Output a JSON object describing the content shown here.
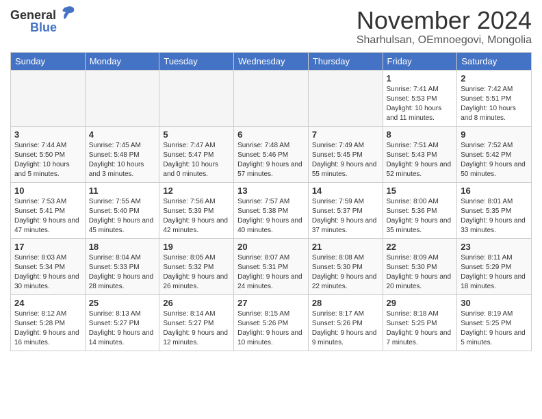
{
  "header": {
    "logo": {
      "general": "General",
      "blue": "Blue"
    },
    "title": "November 2024",
    "location": "Sharhulsan, OEmnoegovi, Mongolia"
  },
  "days_of_week": [
    "Sunday",
    "Monday",
    "Tuesday",
    "Wednesday",
    "Thursday",
    "Friday",
    "Saturday"
  ],
  "weeks": [
    [
      {
        "day": "",
        "info": ""
      },
      {
        "day": "",
        "info": ""
      },
      {
        "day": "",
        "info": ""
      },
      {
        "day": "",
        "info": ""
      },
      {
        "day": "",
        "info": ""
      },
      {
        "day": "1",
        "info": "Sunrise: 7:41 AM\nSunset: 5:53 PM\nDaylight: 10 hours and 11 minutes."
      },
      {
        "day": "2",
        "info": "Sunrise: 7:42 AM\nSunset: 5:51 PM\nDaylight: 10 hours and 8 minutes."
      }
    ],
    [
      {
        "day": "3",
        "info": "Sunrise: 7:44 AM\nSunset: 5:50 PM\nDaylight: 10 hours and 5 minutes."
      },
      {
        "day": "4",
        "info": "Sunrise: 7:45 AM\nSunset: 5:48 PM\nDaylight: 10 hours and 3 minutes."
      },
      {
        "day": "5",
        "info": "Sunrise: 7:47 AM\nSunset: 5:47 PM\nDaylight: 10 hours and 0 minutes."
      },
      {
        "day": "6",
        "info": "Sunrise: 7:48 AM\nSunset: 5:46 PM\nDaylight: 9 hours and 57 minutes."
      },
      {
        "day": "7",
        "info": "Sunrise: 7:49 AM\nSunset: 5:45 PM\nDaylight: 9 hours and 55 minutes."
      },
      {
        "day": "8",
        "info": "Sunrise: 7:51 AM\nSunset: 5:43 PM\nDaylight: 9 hours and 52 minutes."
      },
      {
        "day": "9",
        "info": "Sunrise: 7:52 AM\nSunset: 5:42 PM\nDaylight: 9 hours and 50 minutes."
      }
    ],
    [
      {
        "day": "10",
        "info": "Sunrise: 7:53 AM\nSunset: 5:41 PM\nDaylight: 9 hours and 47 minutes."
      },
      {
        "day": "11",
        "info": "Sunrise: 7:55 AM\nSunset: 5:40 PM\nDaylight: 9 hours and 45 minutes."
      },
      {
        "day": "12",
        "info": "Sunrise: 7:56 AM\nSunset: 5:39 PM\nDaylight: 9 hours and 42 minutes."
      },
      {
        "day": "13",
        "info": "Sunrise: 7:57 AM\nSunset: 5:38 PM\nDaylight: 9 hours and 40 minutes."
      },
      {
        "day": "14",
        "info": "Sunrise: 7:59 AM\nSunset: 5:37 PM\nDaylight: 9 hours and 37 minutes."
      },
      {
        "day": "15",
        "info": "Sunrise: 8:00 AM\nSunset: 5:36 PM\nDaylight: 9 hours and 35 minutes."
      },
      {
        "day": "16",
        "info": "Sunrise: 8:01 AM\nSunset: 5:35 PM\nDaylight: 9 hours and 33 minutes."
      }
    ],
    [
      {
        "day": "17",
        "info": "Sunrise: 8:03 AM\nSunset: 5:34 PM\nDaylight: 9 hours and 30 minutes."
      },
      {
        "day": "18",
        "info": "Sunrise: 8:04 AM\nSunset: 5:33 PM\nDaylight: 9 hours and 28 minutes."
      },
      {
        "day": "19",
        "info": "Sunrise: 8:05 AM\nSunset: 5:32 PM\nDaylight: 9 hours and 26 minutes."
      },
      {
        "day": "20",
        "info": "Sunrise: 8:07 AM\nSunset: 5:31 PM\nDaylight: 9 hours and 24 minutes."
      },
      {
        "day": "21",
        "info": "Sunrise: 8:08 AM\nSunset: 5:30 PM\nDaylight: 9 hours and 22 minutes."
      },
      {
        "day": "22",
        "info": "Sunrise: 8:09 AM\nSunset: 5:30 PM\nDaylight: 9 hours and 20 minutes."
      },
      {
        "day": "23",
        "info": "Sunrise: 8:11 AM\nSunset: 5:29 PM\nDaylight: 9 hours and 18 minutes."
      }
    ],
    [
      {
        "day": "24",
        "info": "Sunrise: 8:12 AM\nSunset: 5:28 PM\nDaylight: 9 hours and 16 minutes."
      },
      {
        "day": "25",
        "info": "Sunrise: 8:13 AM\nSunset: 5:27 PM\nDaylight: 9 hours and 14 minutes."
      },
      {
        "day": "26",
        "info": "Sunrise: 8:14 AM\nSunset: 5:27 PM\nDaylight: 9 hours and 12 minutes."
      },
      {
        "day": "27",
        "info": "Sunrise: 8:15 AM\nSunset: 5:26 PM\nDaylight: 9 hours and 10 minutes."
      },
      {
        "day": "28",
        "info": "Sunrise: 8:17 AM\nSunset: 5:26 PM\nDaylight: 9 hours and 9 minutes."
      },
      {
        "day": "29",
        "info": "Sunrise: 8:18 AM\nSunset: 5:25 PM\nDaylight: 9 hours and 7 minutes."
      },
      {
        "day": "30",
        "info": "Sunrise: 8:19 AM\nSunset: 5:25 PM\nDaylight: 9 hours and 5 minutes."
      }
    ]
  ]
}
